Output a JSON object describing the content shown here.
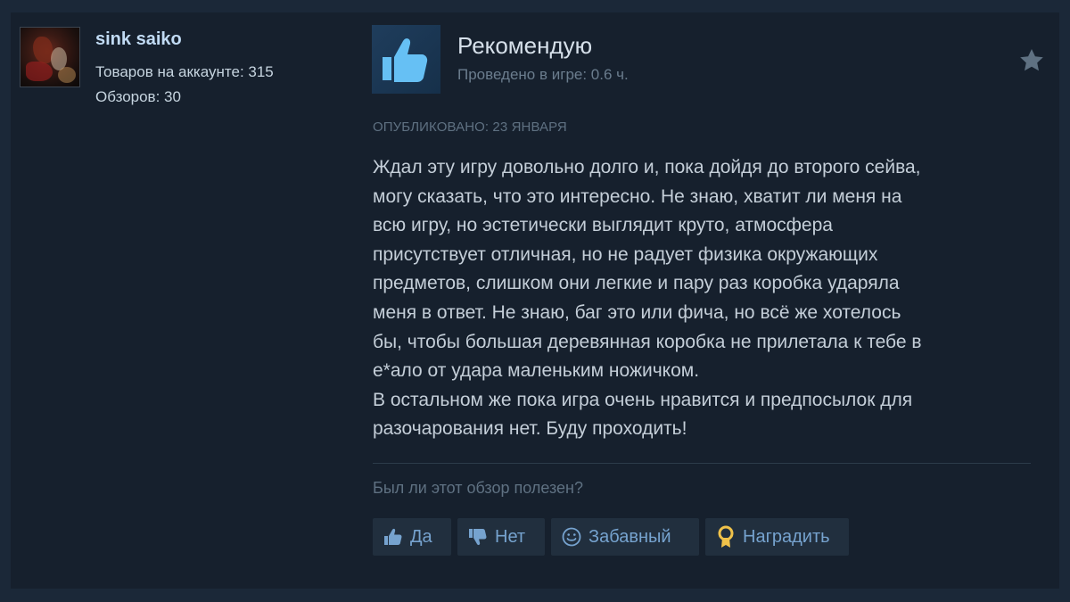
{
  "reviewer": {
    "name": "sink saiko",
    "products_on_account": "Товаров на аккаунте: 315",
    "reviews_count": "Обзоров: 30"
  },
  "review": {
    "verdict": "Рекомендую",
    "playtime": "Проведено в игре: 0.6 ч.",
    "posted": "ОПУБЛИКОВАНО: 23 ЯНВАРЯ",
    "text_lines": [
      "Ждал эту игру довольно долго и, пока дойдя до второго сейва,",
      "могу сказать, что это интересно. Не знаю, хватит ли меня на",
      "всю игру, но эстетически выглядит круто, атмосфера",
      "присутствует отличная, но не радует физика окружающих",
      "предметов, слишком они легкие и пару раз коробка ударяла",
      "меня в ответ. Не знаю, баг это или фича, но всё же хотелось",
      "бы, чтобы большая деревянная коробка не прилетала к тебе в",
      "е*ало от удара маленьким ножичком.",
      "В остальном же пока игра очень нравится и предпосылок для",
      "разочарования нет. Буду проходить!"
    ]
  },
  "feedback": {
    "question": "Был ли этот обзор полезен?",
    "yes_label": "Да",
    "no_label": "Нет",
    "funny_label": "Забавный",
    "award_label": "Наградить"
  },
  "icons": {
    "verdict": "thumbs-up-icon",
    "star": "star-icon",
    "yes": "thumbs-up-icon",
    "no": "thumbs-down-icon",
    "funny": "smiley-icon",
    "award": "award-ribbon-icon"
  },
  "colors": {
    "background": "#1b2838",
    "card": "#16202d",
    "accent_blue": "#76a3cf",
    "award_gold": "#f0c24a"
  }
}
